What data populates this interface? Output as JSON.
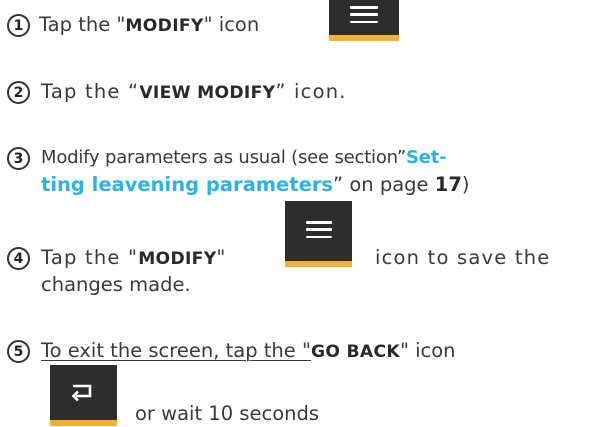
{
  "steps": [
    {
      "number": "1",
      "text_before": "Tap the \"",
      "keyword": "MODIFY",
      "text_after": "\" icon"
    },
    {
      "number": "2",
      "text_before": "Tap the “",
      "keyword": "VIEW MODIFY",
      "text_after": "” icon."
    },
    {
      "number": "3",
      "line1_before": "Modify parameters as usual (see section”",
      "line1_link": "Set-",
      "line2_link": "ting leavening parameters",
      "line2_mid": "” on page ",
      "page_number": "17",
      "line2_end": ")"
    },
    {
      "number": "4",
      "text_before": "Tap the \"",
      "keyword": "MODIFY",
      "text_after": "\"",
      "text_right": "icon to save the",
      "line2": "changes made."
    },
    {
      "number": "5",
      "text_before": "To exit the screen, tap the \"",
      "keyword": "GO BACK",
      "text_after": "\" icon",
      "line2": "or wait 10 seconds"
    }
  ],
  "icons": {
    "modify": "menu-icon",
    "go_back": "return-arrow-icon"
  },
  "colors": {
    "icon_background": "#2d2d2d",
    "icon_accent": "#f2b134",
    "link": "#2bb3e6"
  }
}
